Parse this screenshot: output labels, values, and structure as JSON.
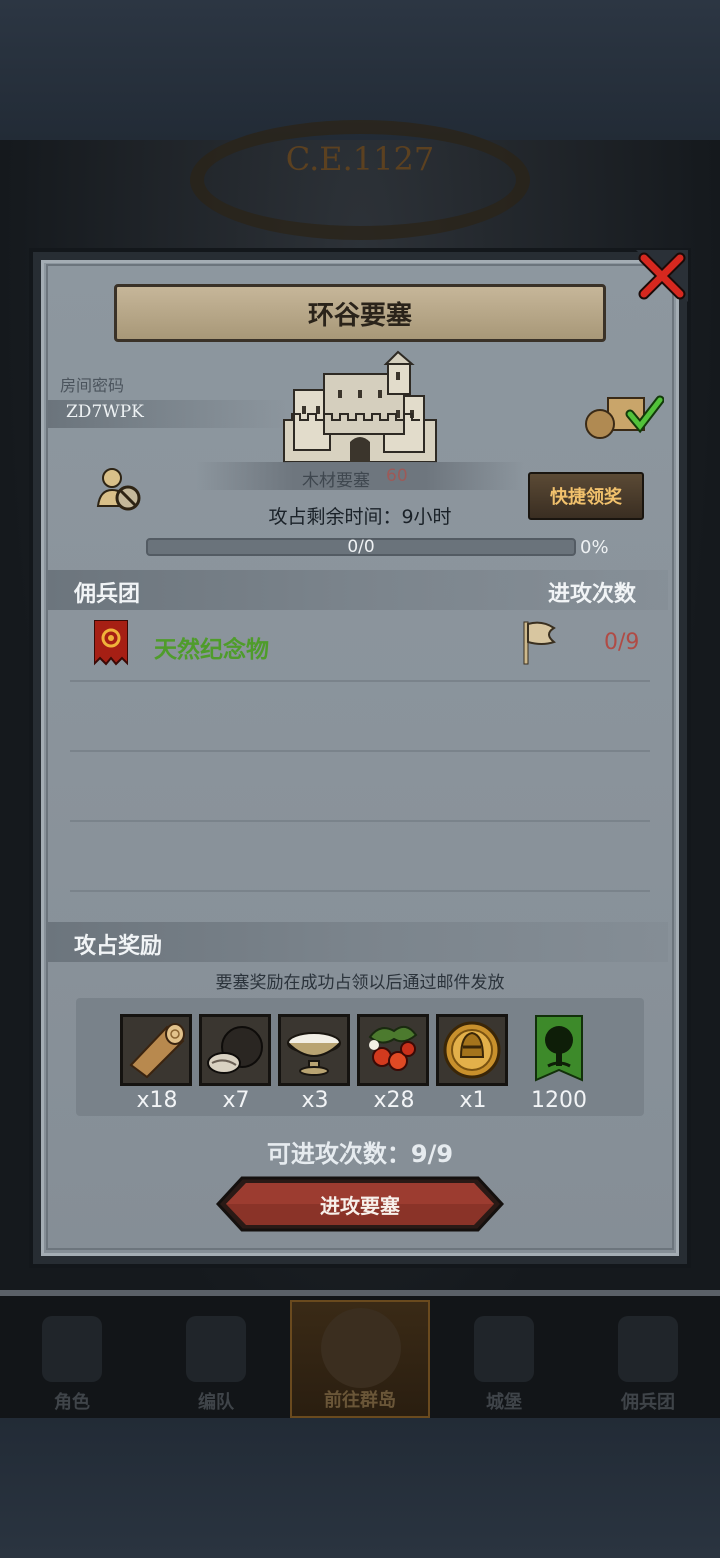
{
  "background": {
    "date": "C.E.1127"
  },
  "panel": {
    "title": "环谷要塞",
    "room_code_label": "房间密码",
    "room_code": "ZD7WPK",
    "fortress_type": "木材要塞",
    "fortress_number": "60",
    "quick_claim_label": "快捷领奖",
    "time_left": "攻占剩余时间：9小时",
    "progress_text": "0/0",
    "progress_percent": "0%",
    "progress_value": 0
  },
  "mercenaries": {
    "header": "佣兵团",
    "attacks_header": "进攻次数",
    "rows": [
      {
        "name": "天然纪念物",
        "attacks": "0/9"
      }
    ]
  },
  "rewards": {
    "header": "攻占奖励",
    "note": "要塞奖励在成功占领以后通过邮件发放",
    "items": [
      {
        "icon": "wood-log-icon",
        "qty": "x18"
      },
      {
        "icon": "truffle-icon",
        "qty": "x7"
      },
      {
        "icon": "cream-bowl-icon",
        "qty": "x3"
      },
      {
        "icon": "berries-icon",
        "qty": "x28"
      },
      {
        "icon": "gold-helmet-medal-icon",
        "qty": "x1"
      },
      {
        "icon": "tree-banner-icon",
        "qty": "1200"
      }
    ]
  },
  "attacks_left": "可进攻次数：9/9",
  "attack_button": "进攻要塞",
  "nav": [
    {
      "label": "角色"
    },
    {
      "label": "编队"
    },
    {
      "label": "前往群岛"
    },
    {
      "label": "城堡"
    },
    {
      "label": "佣兵团"
    }
  ]
}
